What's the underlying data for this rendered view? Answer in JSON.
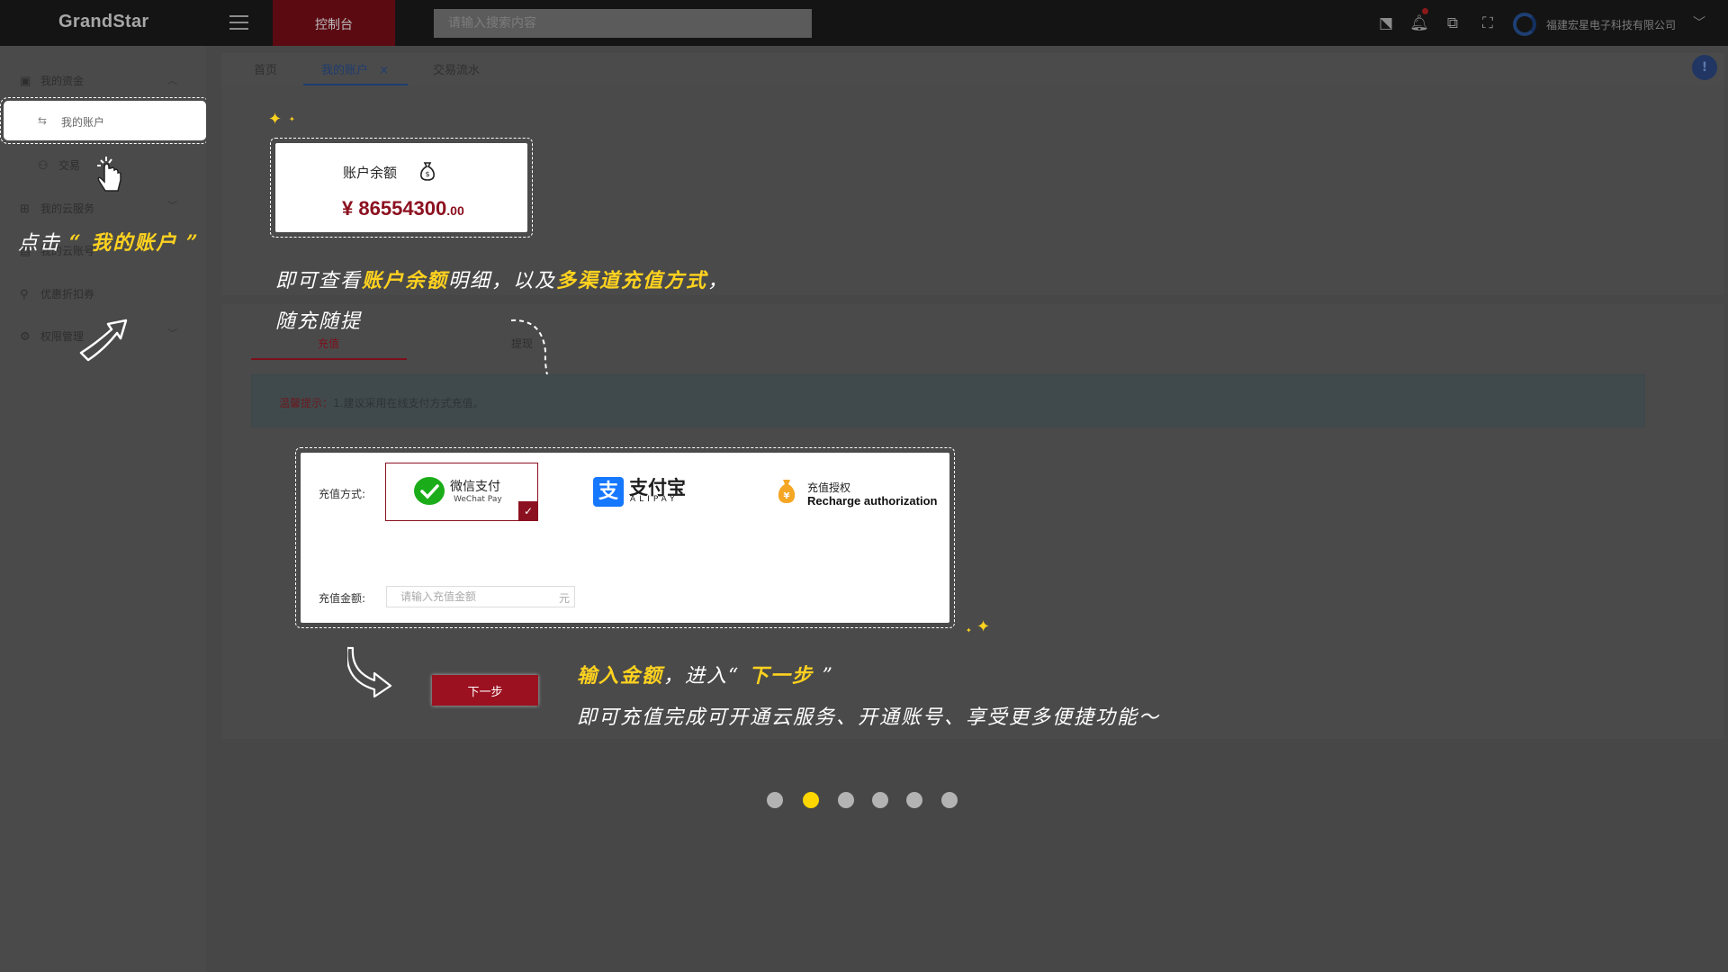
{
  "header": {
    "logo": "GrandStar",
    "console_tab": "控制台",
    "search_placeholder": "请输入搜索内容",
    "company": "福建宏星电子科技有限公司"
  },
  "sidebar": {
    "items": [
      {
        "label": "我的资金",
        "icon": "wallet-icon"
      },
      {
        "label": "我的账户",
        "icon": "transfer-icon"
      },
      {
        "label": "交易流水",
        "icon": "org-icon"
      },
      {
        "label": "我的云服务",
        "icon": "grid-icon"
      },
      {
        "label": "我的云账号",
        "icon": "account-icon"
      },
      {
        "label": "优惠折扣券",
        "icon": "key-icon"
      },
      {
        "label": "权限管理",
        "icon": "gear-icon"
      }
    ],
    "partial": {
      "trade": "交易",
      "cloud_account": "我的云账号",
      "permission": "权限管理"
    }
  },
  "tabs": [
    {
      "label": "首页"
    },
    {
      "label": "我的账户",
      "close": "×"
    },
    {
      "label": "交易流水"
    }
  ],
  "balance": {
    "title": "账户余额",
    "currency": "¥",
    "amount": "86554300",
    "decimal": ".00"
  },
  "annotations": {
    "click_prefix": "点击",
    "click_target": "“ 我的账户 ”",
    "line1_a": "即可查看",
    "line1_b": "账户余额",
    "line1_c": "明细，以及",
    "line1_d": "多渠道充值方式",
    "line1_e": "，",
    "line2": "随充随提",
    "line3_a": "输入金额",
    "line3_b": "，进入“",
    "line3_c": " 下一步 ",
    "line3_d": "”",
    "line4": "即可充值完成可开通云服务、开通账号、享受更多便捷功能～"
  },
  "recharge": {
    "tab_recharge": "充值",
    "tab_withdraw": "提现",
    "notice_label": "温馨提示：",
    "notice_text": "1.建议采用在线支付方式充值。",
    "method_label": "充值方式:",
    "wechat_cn": "微信支付",
    "wechat_en": "WeChat Pay",
    "alipay_cn": "支付宝",
    "alipay_en": "ALIPAY",
    "auth_cn": "充值授权",
    "auth_en": "Recharge authorization",
    "amount_label": "充值金额:",
    "amount_placeholder": "请输入充值金额",
    "unit": "元",
    "next": "下一步"
  },
  "carousel": {
    "count": 6,
    "active_index": 1
  },
  "colors": {
    "accent": "#9c1120",
    "highlight": "#ffd21f",
    "wechat": "#1aad19",
    "alipay": "#1677ff"
  }
}
